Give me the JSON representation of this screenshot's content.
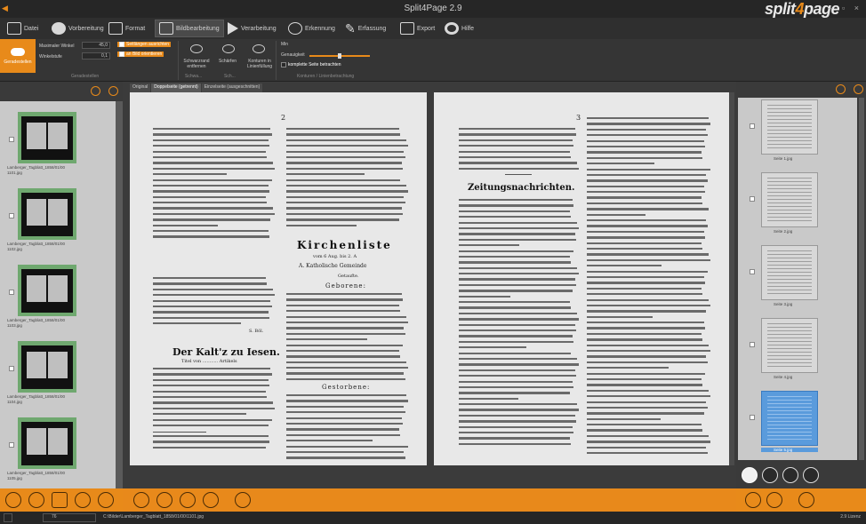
{
  "window": {
    "title": "Split4Page 2.9",
    "logo_part1": "split",
    "logo_part2": "4",
    "logo_part3": "page",
    "controls": "– ▫ ×"
  },
  "tabs": [
    {
      "label": "Datei"
    },
    {
      "label": "Vorbereitung"
    },
    {
      "label": "Format"
    },
    {
      "label": "Bildbearbeitung"
    },
    {
      "label": "Verarbeitung"
    },
    {
      "label": "Erkennung"
    },
    {
      "label": "Erfassung"
    },
    {
      "label": "Export"
    },
    {
      "label": "Hilfe"
    }
  ],
  "ribbon": {
    "main_button": "Geradestellen",
    "max_angle_label": "Maximaler Winkel",
    "max_angle_value": "45,0",
    "increment_label": "Winkelstufe",
    "increment_value": "0,1",
    "chk1": "Seitlängen ausrichten",
    "chk2": "an Bild orientieren",
    "btn_schwarzrand": "Schwarzrand entfernen",
    "btn_scharfen": "Schärfen",
    "btn_konturen": "Konturen in Linienfüllung",
    "ausgabe_label": "Min",
    "genauigkeit_label": "Genauigkeit",
    "chk3": "komplette Seite betrachten",
    "group1": "Geradestellen",
    "group2": "Schwa...",
    "group3": "Sch...",
    "group4": "Konturen / Linienbetrachtung"
  },
  "left_thumbs": [
    {
      "caption": "Lamberger_Tagblatt_1858/01/00\n1101.jpg"
    },
    {
      "caption": "Lamberger_Tagblatt_1858/01/00\n1102.jpg"
    },
    {
      "caption": "Lamberger_Tagblatt_1858/01/00\n1103.jpg"
    },
    {
      "caption": "Lamberger_Tagblatt_1858/01/00\n1104.jpg"
    },
    {
      "caption": "Lamberger_Tagblatt_1858/01/00\n1105.jpg"
    }
  ],
  "center": {
    "subtabs": [
      "Original",
      "Doppelseite (getrennt)",
      "Einzelseite (ausgeschnitten)"
    ],
    "left_page_number": "2",
    "right_page_number": "3",
    "heading_kirchenliste": "Kirchenliste",
    "sub_kirchenliste": "vom 6 Aug. bis 2. A",
    "sub_a": "A. Katholische Gemeinde",
    "sub_taufe": "Getaufte.",
    "sub_geborene": "Geborene:",
    "sub_gestorbene": "Gestorbene:",
    "heading_kalt": "Der Kalt'z zu Iesen.",
    "sub_kalt": "Titel von ........... Artikels",
    "heading_zeitung": "Zeitungsnachrichten.",
    "signature": "S. Böl."
  },
  "right_thumbs": [
    {
      "caption": "Seite 1.jpg"
    },
    {
      "caption": "Seite 2.jpg"
    },
    {
      "caption": "Seite 3.jpg"
    },
    {
      "caption": "Seite 4.jpg"
    },
    {
      "caption": "Seite 5.jpg"
    }
  ],
  "status": {
    "zoom": "76",
    "path": "C:\\Bilder\\Lamberger_Tagblatt_1858/01/00\\1101.jpg",
    "version": "2.9 Lizenz"
  },
  "colors": {
    "accent": "#e88a1a",
    "bg": "#2b2b2b",
    "panel": "#3a3a3a"
  }
}
